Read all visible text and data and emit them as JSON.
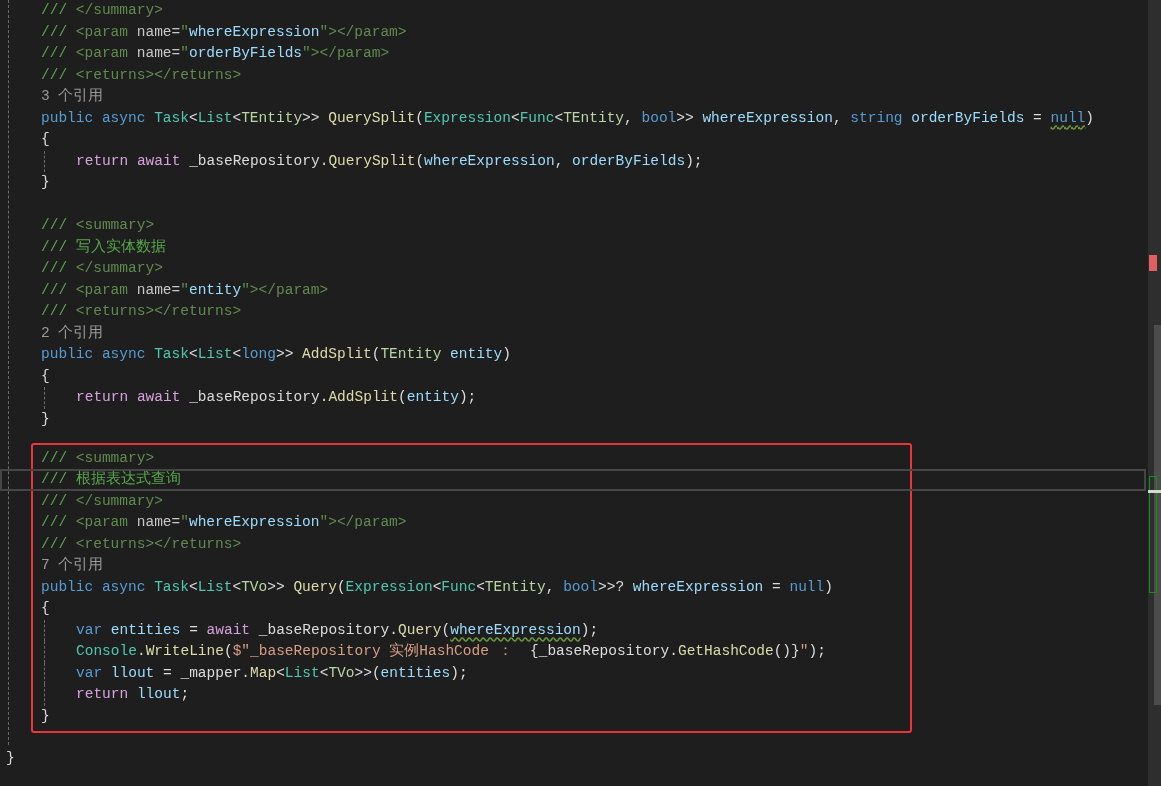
{
  "editor": {
    "members": [
      {
        "framed": false,
        "lines": [
          {
            "kind": "code",
            "tokens": [
              {
                "kind": "comment",
                "text": "/// "
              },
              {
                "kind": "doctag",
                "text": "</summary>"
              }
            ]
          },
          {
            "kind": "code",
            "tokens": [
              {
                "kind": "comment",
                "text": "/// "
              },
              {
                "kind": "doctag",
                "text": "<param "
              },
              {
                "kind": "docattr",
                "text": "name="
              },
              {
                "kind": "doctag",
                "text": "\""
              },
              {
                "kind": "docvalue",
                "text": "whereExpression"
              },
              {
                "kind": "doctag",
                "text": "\"></param>"
              }
            ]
          },
          {
            "kind": "code",
            "tokens": [
              {
                "kind": "comment",
                "text": "/// "
              },
              {
                "kind": "doctag",
                "text": "<param "
              },
              {
                "kind": "docattr",
                "text": "name="
              },
              {
                "kind": "doctag",
                "text": "\""
              },
              {
                "kind": "docvalue",
                "text": "orderByFields"
              },
              {
                "kind": "doctag",
                "text": "\"></param>"
              }
            ]
          },
          {
            "kind": "code",
            "tokens": [
              {
                "kind": "comment",
                "text": "/// "
              },
              {
                "kind": "doctag",
                "text": "<returns></returns>"
              }
            ]
          },
          {
            "kind": "codelens",
            "text": "3 个引用"
          },
          {
            "kind": "code",
            "tokens": [
              {
                "kind": "keyword",
                "text": "public "
              },
              {
                "kind": "keyword",
                "text": "async "
              },
              {
                "kind": "type",
                "text": "Task"
              },
              {
                "kind": "plain",
                "text": "<"
              },
              {
                "kind": "type",
                "text": "List"
              },
              {
                "kind": "plain",
                "text": "<"
              },
              {
                "kind": "typeparam",
                "text": "TEntity"
              },
              {
                "kind": "plain",
                "text": ">> "
              },
              {
                "kind": "method",
                "text": "QuerySplit"
              },
              {
                "kind": "plain",
                "text": "("
              },
              {
                "kind": "type",
                "text": "Expression"
              },
              {
                "kind": "plain",
                "text": "<"
              },
              {
                "kind": "type",
                "text": "Func"
              },
              {
                "kind": "plain",
                "text": "<"
              },
              {
                "kind": "typeparam",
                "text": "TEntity"
              },
              {
                "kind": "plain",
                "text": ", "
              },
              {
                "kind": "keyword",
                "text": "bool"
              },
              {
                "kind": "plain",
                "text": ">> "
              },
              {
                "kind": "param",
                "text": "whereExpression"
              },
              {
                "kind": "plain",
                "text": ", "
              },
              {
                "kind": "keyword",
                "text": "string "
              },
              {
                "kind": "param",
                "text": "orderByFields"
              },
              {
                "kind": "plain",
                "text": " = "
              },
              {
                "kind": "keyword",
                "text": "null",
                "squiggle": true
              },
              {
                "kind": "plain",
                "text": ")"
              }
            ]
          },
          {
            "kind": "code",
            "tokens": [
              {
                "kind": "plain",
                "text": "{"
              }
            ],
            "children": [
              {
                "kind": "code",
                "tokens": [
                  {
                    "kind": "control",
                    "text": "return "
                  },
                  {
                    "kind": "control",
                    "text": "await"
                  },
                  {
                    "kind": "plain",
                    "text": " _baseRepository."
                  },
                  {
                    "kind": "method",
                    "text": "QuerySplit"
                  },
                  {
                    "kind": "plain",
                    "text": "("
                  },
                  {
                    "kind": "param",
                    "text": "whereExpression"
                  },
                  {
                    "kind": "plain",
                    "text": ", "
                  },
                  {
                    "kind": "param",
                    "text": "orderByFields"
                  },
                  {
                    "kind": "plain",
                    "text": ");"
                  }
                ]
              }
            ]
          },
          {
            "kind": "code",
            "tokens": [
              {
                "kind": "plain",
                "text": "}"
              }
            ]
          },
          {
            "kind": "blank"
          },
          {
            "kind": "code",
            "tokens": [
              {
                "kind": "comment",
                "text": "/// "
              },
              {
                "kind": "doctag",
                "text": "<summary>"
              }
            ]
          },
          {
            "kind": "code",
            "tokens": [
              {
                "kind": "comment",
                "text": "/// 写入实体数据"
              }
            ]
          },
          {
            "kind": "code",
            "tokens": [
              {
                "kind": "comment",
                "text": "/// "
              },
              {
                "kind": "doctag",
                "text": "</summary>"
              }
            ]
          },
          {
            "kind": "code",
            "tokens": [
              {
                "kind": "comment",
                "text": "/// "
              },
              {
                "kind": "doctag",
                "text": "<param "
              },
              {
                "kind": "docattr",
                "text": "name="
              },
              {
                "kind": "doctag",
                "text": "\""
              },
              {
                "kind": "docvalue",
                "text": "entity"
              },
              {
                "kind": "doctag",
                "text": "\"></param>"
              }
            ]
          },
          {
            "kind": "code",
            "tokens": [
              {
                "kind": "comment",
                "text": "/// "
              },
              {
                "kind": "doctag",
                "text": "<returns></returns>"
              }
            ]
          },
          {
            "kind": "codelens",
            "text": "2 个引用"
          },
          {
            "kind": "code",
            "tokens": [
              {
                "kind": "keyword",
                "text": "public "
              },
              {
                "kind": "keyword",
                "text": "async "
              },
              {
                "kind": "type",
                "text": "Task"
              },
              {
                "kind": "plain",
                "text": "<"
              },
              {
                "kind": "type",
                "text": "List"
              },
              {
                "kind": "plain",
                "text": "<"
              },
              {
                "kind": "keyword",
                "text": "long"
              },
              {
                "kind": "plain",
                "text": ">> "
              },
              {
                "kind": "method",
                "text": "AddSplit"
              },
              {
                "kind": "plain",
                "text": "("
              },
              {
                "kind": "typeparam",
                "text": "TEntity "
              },
              {
                "kind": "param",
                "text": "entity"
              },
              {
                "kind": "plain",
                "text": ")"
              }
            ]
          },
          {
            "kind": "code",
            "tokens": [
              {
                "kind": "plain",
                "text": "{"
              }
            ],
            "children": [
              {
                "kind": "code",
                "tokens": [
                  {
                    "kind": "control",
                    "text": "return "
                  },
                  {
                    "kind": "control",
                    "text": "await"
                  },
                  {
                    "kind": "plain",
                    "text": " _baseRepository."
                  },
                  {
                    "kind": "method",
                    "text": "AddSplit"
                  },
                  {
                    "kind": "plain",
                    "text": "("
                  },
                  {
                    "kind": "param",
                    "text": "entity"
                  },
                  {
                    "kind": "plain",
                    "text": ");"
                  }
                ]
              }
            ]
          },
          {
            "kind": "code",
            "tokens": [
              {
                "kind": "plain",
                "text": "}"
              }
            ]
          },
          {
            "kind": "blank"
          }
        ]
      },
      {
        "framed": true,
        "lines": [
          {
            "kind": "code",
            "tokens": [
              {
                "kind": "comment",
                "text": "/// "
              },
              {
                "kind": "doctag",
                "text": "<summary>"
              }
            ]
          },
          {
            "kind": "code",
            "current": true,
            "tokens": [
              {
                "kind": "comment",
                "text": "/// 根据表达式查询"
              }
            ]
          },
          {
            "kind": "code",
            "tokens": [
              {
                "kind": "comment",
                "text": "/// "
              },
              {
                "kind": "doctag",
                "text": "</summary>"
              }
            ]
          },
          {
            "kind": "code",
            "tokens": [
              {
                "kind": "comment",
                "text": "/// "
              },
              {
                "kind": "doctag",
                "text": "<param "
              },
              {
                "kind": "docattr",
                "text": "name="
              },
              {
                "kind": "doctag",
                "text": "\""
              },
              {
                "kind": "docvalue",
                "text": "whereExpression"
              },
              {
                "kind": "doctag",
                "text": "\"></param>"
              }
            ]
          },
          {
            "kind": "code",
            "tokens": [
              {
                "kind": "comment",
                "text": "/// "
              },
              {
                "kind": "doctag",
                "text": "<returns></returns>"
              }
            ]
          },
          {
            "kind": "codelens",
            "text": "7 个引用"
          },
          {
            "kind": "code",
            "tokens": [
              {
                "kind": "keyword",
                "text": "public "
              },
              {
                "kind": "keyword",
                "text": "async "
              },
              {
                "kind": "type",
                "text": "Task"
              },
              {
                "kind": "plain",
                "text": "<"
              },
              {
                "kind": "type",
                "text": "List"
              },
              {
                "kind": "plain",
                "text": "<"
              },
              {
                "kind": "typeparam",
                "text": "TVo"
              },
              {
                "kind": "plain",
                "text": ">> "
              },
              {
                "kind": "method",
                "text": "Query"
              },
              {
                "kind": "plain",
                "text": "("
              },
              {
                "kind": "type",
                "text": "Expression"
              },
              {
                "kind": "plain",
                "text": "<"
              },
              {
                "kind": "type",
                "text": "Func"
              },
              {
                "kind": "plain",
                "text": "<"
              },
              {
                "kind": "typeparam",
                "text": "TEntity"
              },
              {
                "kind": "plain",
                "text": ", "
              },
              {
                "kind": "keyword",
                "text": "bool"
              },
              {
                "kind": "plain",
                "text": ">>? "
              },
              {
                "kind": "param",
                "text": "whereExpression"
              },
              {
                "kind": "plain",
                "text": " = "
              },
              {
                "kind": "keyword",
                "text": "null"
              },
              {
                "kind": "plain",
                "text": ")"
              }
            ]
          },
          {
            "kind": "code",
            "tokens": [
              {
                "kind": "plain",
                "text": "{"
              }
            ],
            "children": [
              {
                "kind": "code",
                "tokens": [
                  {
                    "kind": "keyword",
                    "text": "var "
                  },
                  {
                    "kind": "local",
                    "text": "entities"
                  },
                  {
                    "kind": "plain",
                    "text": " = "
                  },
                  {
                    "kind": "control",
                    "text": "await"
                  },
                  {
                    "kind": "plain",
                    "text": " _baseRepository."
                  },
                  {
                    "kind": "method",
                    "text": "Query"
                  },
                  {
                    "kind": "plain",
                    "text": "("
                  },
                  {
                    "kind": "param",
                    "text": "whereExpression",
                    "squiggle": true
                  },
                  {
                    "kind": "plain",
                    "text": ");"
                  }
                ]
              },
              {
                "kind": "code",
                "tokens": [
                  {
                    "kind": "type",
                    "text": "Console"
                  },
                  {
                    "kind": "plain",
                    "text": "."
                  },
                  {
                    "kind": "method",
                    "text": "WriteLine"
                  },
                  {
                    "kind": "plain",
                    "text": "("
                  },
                  {
                    "kind": "string",
                    "text": "$\"_baseRepository 实例HashCode ：  "
                  },
                  {
                    "kind": "plain",
                    "text": "{_baseRepository."
                  },
                  {
                    "kind": "method",
                    "text": "GetHashCode"
                  },
                  {
                    "kind": "plain",
                    "text": "()}"
                  },
                  {
                    "kind": "string",
                    "text": "\""
                  },
                  {
                    "kind": "plain",
                    "text": ");"
                  }
                ]
              },
              {
                "kind": "code",
                "tokens": [
                  {
                    "kind": "keyword",
                    "text": "var "
                  },
                  {
                    "kind": "local",
                    "text": "llout"
                  },
                  {
                    "kind": "plain",
                    "text": " = _mapper."
                  },
                  {
                    "kind": "method",
                    "text": "Map"
                  },
                  {
                    "kind": "plain",
                    "text": "<"
                  },
                  {
                    "kind": "type",
                    "text": "List"
                  },
                  {
                    "kind": "plain",
                    "text": "<"
                  },
                  {
                    "kind": "typeparam",
                    "text": "TVo"
                  },
                  {
                    "kind": "plain",
                    "text": ">>("
                  },
                  {
                    "kind": "local",
                    "text": "entities"
                  },
                  {
                    "kind": "plain",
                    "text": ");"
                  }
                ]
              },
              {
                "kind": "code",
                "tokens": [
                  {
                    "kind": "control",
                    "text": "return "
                  },
                  {
                    "kind": "local",
                    "text": "llout"
                  },
                  {
                    "kind": "plain",
                    "text": ";"
                  }
                ]
              }
            ]
          },
          {
            "kind": "code",
            "tokens": [
              {
                "kind": "plain",
                "text": "}"
              }
            ]
          }
        ]
      },
      {
        "framed": false,
        "lines": [
          {
            "kind": "blank"
          }
        ]
      }
    ],
    "closing_lines": [
      {
        "kind": "code",
        "tokens": [
          {
            "kind": "plain",
            "text": "}"
          }
        ]
      }
    ]
  }
}
